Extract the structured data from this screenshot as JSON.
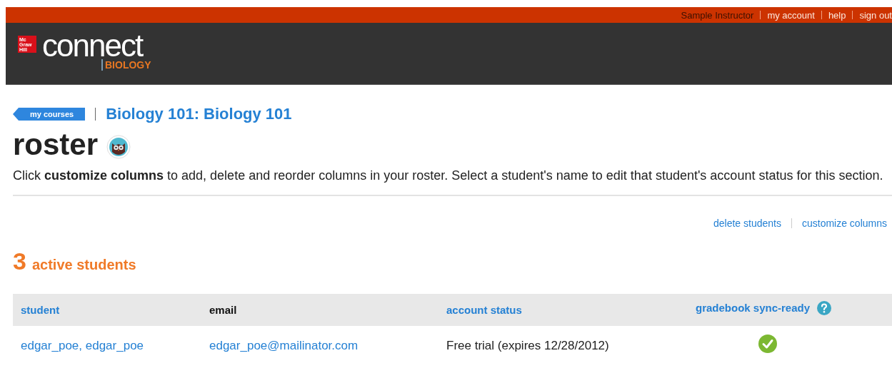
{
  "top_bar": {
    "user": "Sample Instructor",
    "links": [
      "my account",
      "help",
      "sign out"
    ]
  },
  "logo": {
    "badge": [
      "Mc",
      "Graw",
      "Hill"
    ],
    "wordmark": "connect",
    "subject": "BIOLOGY"
  },
  "breadcrumb": {
    "back": "my courses",
    "course": "Biology 101: Biology 101"
  },
  "page_title": "roster",
  "intro": "Click **customize columns** to add, delete and reorder columns in your roster. Select a student's name to edit that student's account status for this section.",
  "actions": [
    "delete students",
    "customize columns"
  ],
  "count": {
    "number": "3",
    "label": "active students"
  },
  "table": {
    "columns": [
      {
        "label": "student",
        "sortable": true
      },
      {
        "label": "email",
        "sortable": false
      },
      {
        "label": "account status",
        "sortable": true
      },
      {
        "label": "gradebook sync-ready",
        "sortable": true,
        "help": true
      }
    ],
    "rows": [
      {
        "student": "edgar_poe, edgar_poe",
        "email": "edgar_poe@mailinator.com",
        "status": "Free trial (expires 12/28/2012)",
        "synced": true
      }
    ]
  }
}
